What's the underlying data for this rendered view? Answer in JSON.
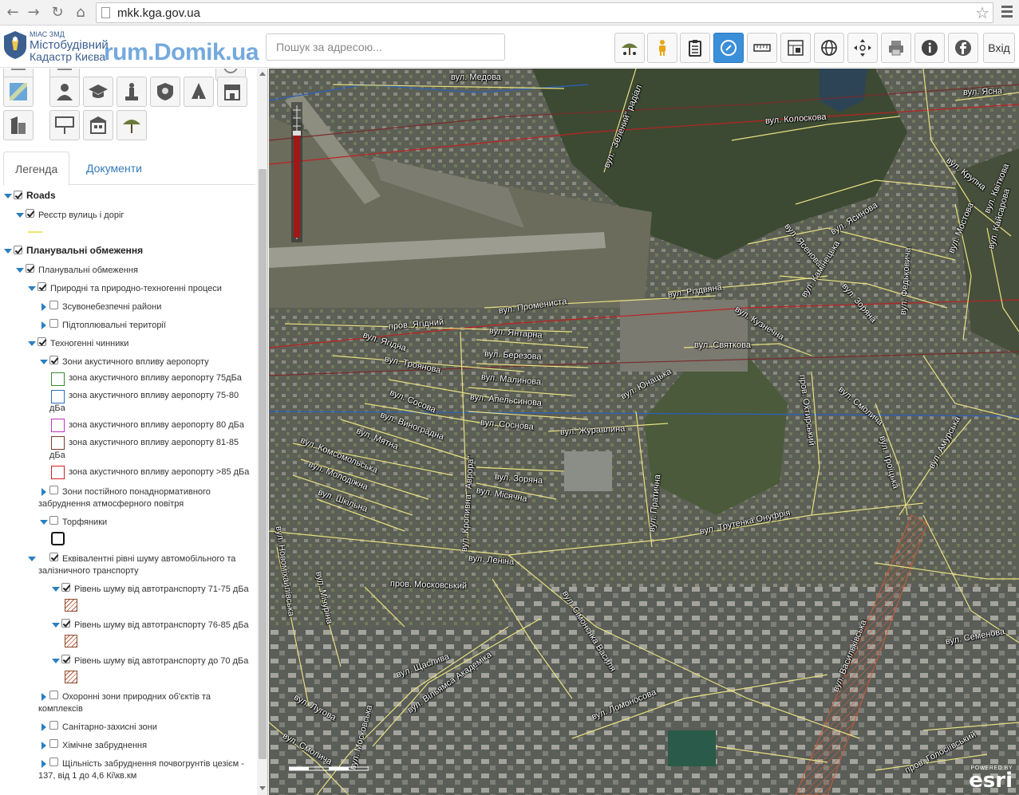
{
  "browser": {
    "url": "mkk.kga.gov.ua"
  },
  "header": {
    "org_small": "МІАС ЗМД",
    "org_line1": "Містобудівний",
    "org_line2": "Кадастр Києва",
    "watermark": "rum.Domik.ua",
    "search_placeholder": "Пошук за адресою...",
    "exit_label": "Вхід",
    "toolbar": [
      "umbrella-icon",
      "pegman-icon",
      "clipboard-icon",
      "compass-icon",
      "ruler-icon",
      "measure-icon",
      "globe-icon",
      "move-icon",
      "print-icon",
      "info-icon",
      "facebook-icon"
    ]
  },
  "tabs": {
    "legend": "Легенда",
    "documents": "Документи"
  },
  "legend": {
    "roads": "Roads",
    "roads_registry": "Реєстр вулиць і доріг",
    "planning": "Планувальні обмеження",
    "planning_sub": "Планувальні обмеження",
    "natural": "Природні та природно-техногенні процеси",
    "landslide": "Зсувонебезпечні райони",
    "flooded": "Підтоплювальні території",
    "technogenic": "Техногенні чинники",
    "airport_zones": "Зони акустичного впливу аеропорту",
    "airport_75": "зона акустичного впливу аеропорту 75дБа",
    "airport_75_80_a": "зона акустичного впливу аеропорту 75-80",
    "airport_75_80_b": "дБа",
    "airport_80": "зона акустичного впливу аеропорту 80 дБа",
    "airport_81_85_a": "зона акустичного впливу аеропорту 81-85",
    "airport_81_85_b": "дБа",
    "airport_85": "зона акустичного впливу аеропорту >85 дБа",
    "air_pollution_a": "Зони постійного понаднормативного",
    "air_pollution_b": "забруднення атмосферного повітря",
    "peat": "Торфяники",
    "noise_a": "Еквівалентні рівні шуму автомобільного та",
    "noise_b": "залізничного транспорту",
    "noise_71_75": "Рівень шуму від автотранспорту 71-75 дБа",
    "noise_76_85": "Рівень шуму від автотранспорту 76-85 дБа",
    "noise_70": "Рівень шуму від автотранспорту до 70 дБа",
    "protected_a": "Охоронні зони природних об'єктів та",
    "protected_b": "комплексів",
    "sanitary": "Санітарно-захисні зони",
    "chemical": "Хімічне забруднення",
    "cesium_a": "Щільність забруднення почвогрунтів цезієм -",
    "cesium_b": "137, від 1 до 4,6 Кі\\кв.км"
  },
  "colors": {
    "airport_75": "#3a8a2e",
    "airport_75_80": "#2a6fc0",
    "airport_80": "#c230c0",
    "airport_81_85": "#7a3a2a",
    "airport_85": "#d02020",
    "accent": "#3b8fd9"
  },
  "map": {
    "streets": [
      {
        "name": "вул. Медова"
      },
      {
        "name": "вул. \"Зелений\" радіал"
      },
      {
        "name": "вул. Колоскова"
      },
      {
        "name": "вул. Ясна"
      },
      {
        "name": "вул. Крупна"
      },
      {
        "name": "вул. Ясенова"
      },
      {
        "name": "вул. Ясинова"
      },
      {
        "name": "вул. Мостова"
      },
      {
        "name": "вул. Квіткова"
      },
      {
        "name": "вул. Кайсарова"
      },
      {
        "name": "вул. Камінецька"
      },
      {
        "name": "вул. Зоряна"
      },
      {
        "name": "вул. Федьковича"
      },
      {
        "name": "вул. Різдвяна"
      },
      {
        "name": "вул. Кузнечна"
      },
      {
        "name": "вул. Променистa"
      },
      {
        "name": "пров. Ягідний"
      },
      {
        "name": "вул. Янтарна"
      },
      {
        "name": "вул. Ягідна"
      },
      {
        "name": "вул. Березова"
      },
      {
        "name": "вул. Святкова"
      },
      {
        "name": "вул. Троянова"
      },
      {
        "name": "вул. Малинова"
      },
      {
        "name": "вул. Сосова"
      },
      {
        "name": "вул. Апельсинова"
      },
      {
        "name": "вул. Юнацька"
      },
      {
        "name": "вул. Виноградна"
      },
      {
        "name": "вул. Соснова"
      },
      {
        "name": "вул. Журавлина"
      },
      {
        "name": "вул. Мятна"
      },
      {
        "name": "вул. Комсомольська"
      },
      {
        "name": "вул. Молодіжна"
      },
      {
        "name": "вул. Зоряна"
      },
      {
        "name": "вул. Місячна"
      },
      {
        "name": "вул. Шкільна"
      },
      {
        "name": "вул. Кропивна \"Аврора\""
      },
      {
        "name": "вул. Пратична"
      },
      {
        "name": "вул. Трутенка Онуфрія"
      },
      {
        "name": "вул. Смолича"
      },
      {
        "name": "вул. Троїцька"
      },
      {
        "name": "вул. Амурська"
      },
      {
        "name": "пров. Охтирський"
      },
      {
        "name": "вул. Леніна"
      },
      {
        "name": "пров. Московський"
      },
      {
        "name": "вул. Новоміхайлівська"
      },
      {
        "name": "вул. Мічуріна"
      },
      {
        "name": "вул. Сімонєнка Василя"
      },
      {
        "name": "вул. Щаслива"
      },
      {
        "name": "вул. Вільямса Академіка"
      },
      {
        "name": "вул. Ломоносова"
      },
      {
        "name": "вул. Московська"
      },
      {
        "name": "вул. Лугова"
      },
      {
        "name": "вул. Смолича"
      },
      {
        "name": "вул. Васильківська"
      },
      {
        "name": "вул. Семенова"
      },
      {
        "name": "пров. Голосіївський"
      }
    ]
  },
  "esri": {
    "powered": "POWERED BY",
    "name": "esri"
  }
}
